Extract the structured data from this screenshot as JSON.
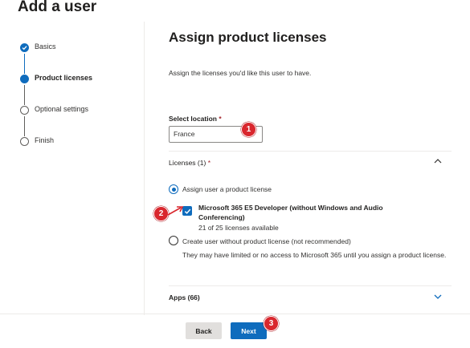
{
  "page_title": "Add a user",
  "steps": [
    {
      "label": "Basics",
      "state": "done"
    },
    {
      "label": "Product licenses",
      "state": "current"
    },
    {
      "label": "Optional settings",
      "state": "todo"
    },
    {
      "label": "Finish",
      "state": "todo"
    }
  ],
  "main": {
    "title": "Assign product licenses",
    "description": "Assign the licenses you'd like this user to have.",
    "location": {
      "label": "Select location",
      "required_mark": "*",
      "value": "France"
    },
    "licenses": {
      "header": "Licenses (1)",
      "required_mark": "*",
      "assign_option": "Assign user a product license",
      "license_name": "Microsoft 365 E5 Developer (without Windows and Audio Conferencing)",
      "license_availability": "21 of 25 licenses available",
      "no_license_option": "Create user without product license (not recommended)",
      "no_license_warning": "They may have limited or no access to Microsoft 365 until you assign a product license."
    },
    "apps": {
      "header": "Apps (66)"
    }
  },
  "footer": {
    "back_label": "Back",
    "next_label": "Next"
  },
  "annotations": [
    "1",
    "2",
    "3"
  ],
  "colors": {
    "accent": "#0f6cbd",
    "badge": "#d9272e"
  }
}
